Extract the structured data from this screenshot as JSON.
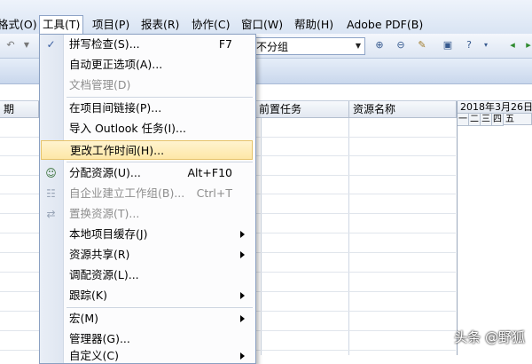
{
  "menubar": {
    "items": [
      {
        "label": "格式(O)"
      },
      {
        "label": "工具(T)"
      },
      {
        "label": "项目(P)"
      },
      {
        "label": "报表(R)"
      },
      {
        "label": "协作(C)"
      },
      {
        "label": "窗口(W)"
      },
      {
        "label": "帮助(H)"
      },
      {
        "label": "Adobe PDF(B)"
      }
    ]
  },
  "toolbar": {
    "group_value": "不分组",
    "icons": [
      "undo-icon",
      "zoom-in-icon",
      "zoom-out-icon",
      "link-icon",
      "copy-picture-icon",
      "help-icon",
      "arrow-left-icon",
      "arrow-right-icon"
    ]
  },
  "grid": {
    "columns": [
      "期",
      "前置任务",
      "资源名称"
    ],
    "gantt_date": "2018年3月26日",
    "gantt_days": [
      "一",
      "二",
      "三",
      "四",
      "五"
    ]
  },
  "tools_menu": {
    "items": [
      {
        "label": "拼写检查(S)...",
        "shortcut": "F7",
        "icon": "spell-check-icon"
      },
      {
        "label": "自动更正选项(A)...",
        "shortcut": "",
        "icon": ""
      },
      {
        "label": "文档管理(D)",
        "shortcut": "",
        "icon": "",
        "disabled": true
      },
      {
        "label": "在项目间链接(P)...",
        "shortcut": "",
        "icon": ""
      },
      {
        "label": "导入 Outlook 任务(I)...",
        "shortcut": "",
        "icon": ""
      },
      {
        "label": "更改工作时间(H)...",
        "shortcut": "",
        "icon": "",
        "highlighted": true
      },
      {
        "label": "分配资源(U)...",
        "shortcut": "Alt+F10",
        "icon": "assign-resources-icon"
      },
      {
        "label": "自企业建立工作组(B)...",
        "shortcut": "Ctrl+T",
        "icon": "team-icon",
        "disabled": true
      },
      {
        "label": "置换资源(T)...",
        "shortcut": "",
        "icon": "replace-resources-icon",
        "disabled": true
      },
      {
        "label": "本地项目缓存(J)",
        "shortcut": "",
        "icon": "",
        "submenu": true
      },
      {
        "label": "资源共享(R)",
        "shortcut": "",
        "icon": "",
        "submenu": true
      },
      {
        "label": "调配资源(L)...",
        "shortcut": "",
        "icon": ""
      },
      {
        "label": "跟踪(K)",
        "shortcut": "",
        "icon": "",
        "submenu": true
      },
      {
        "label": "宏(M)",
        "shortcut": "",
        "icon": "",
        "submenu": true
      },
      {
        "label": "管理器(G)...",
        "shortcut": "",
        "icon": ""
      },
      {
        "label": "自定义(C)",
        "shortcut": "",
        "icon": "",
        "submenu": true
      }
    ]
  },
  "watermark": "头条 @野狐"
}
